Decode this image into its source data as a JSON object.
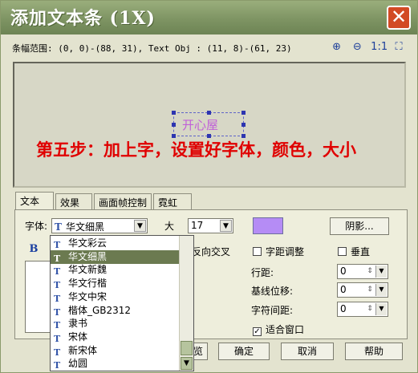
{
  "window": {
    "title": "添加文本条 (1X)",
    "close_glyph": "✕"
  },
  "bounds_text": "条幅范围: (0, 0)-(88, 31), Text Obj : (11, 8)-(61, 23)",
  "zoom": {
    "zoom_in": "⊕",
    "zoom_out": "⊖",
    "actual": "1:1",
    "fit": "⛶"
  },
  "preview": {
    "selected_text": "开心屋",
    "step_line": "第五步：加上字，设置好字体，颜色，大小"
  },
  "tabs": [
    "文本",
    "效果",
    "画面帧控制",
    "霓虹"
  ],
  "font": {
    "label": "字体:",
    "value": "华文细黑"
  },
  "size": {
    "label": "大",
    "value": "17"
  },
  "color": "#b58cf5",
  "shadow_button": "阴影...",
  "bold_label": "B",
  "reverse_label": "反向交叉",
  "options": {
    "kerning": "字距调整",
    "vertical": "垂直",
    "line_spacing": "行距:",
    "baseline": "基线位移:",
    "char_spacing": "字符间距:",
    "fit_window": "适合窗口"
  },
  "spin_values": {
    "line_spacing": "0",
    "baseline": "0",
    "char_spacing": "0"
  },
  "buttons": {
    "ok": "确定",
    "cancel": "取消",
    "help": "帮助",
    "partial": "览"
  },
  "font_list": [
    {
      "name": "华文彩云",
      "selected": false
    },
    {
      "name": "华文细黑",
      "selected": true
    },
    {
      "name": "华文新魏",
      "selected": false
    },
    {
      "name": "华文行楷",
      "selected": false
    },
    {
      "name": "华文中宋",
      "selected": false
    },
    {
      "name": "楷体_GB2312",
      "selected": false
    },
    {
      "name": "隶书",
      "selected": false
    },
    {
      "name": "宋体",
      "selected": false
    },
    {
      "name": "新宋体",
      "selected": false
    },
    {
      "name": "幼圆",
      "selected": false
    }
  ],
  "font_icon": "T"
}
